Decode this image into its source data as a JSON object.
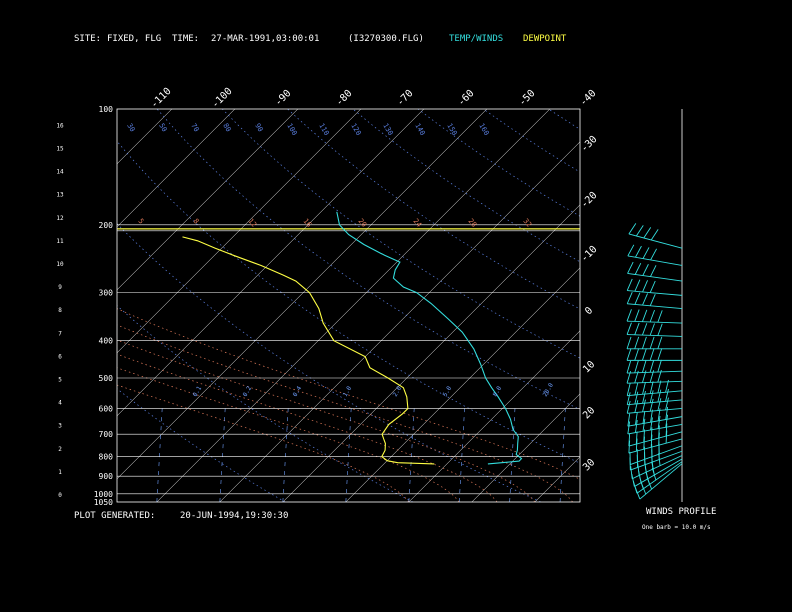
{
  "header": {
    "site_label": "SITE:",
    "site_value": "FIXED, FLG",
    "time_label": "TIME:",
    "time_value": "27-MAR-1991,03:00:01",
    "file_value": "(I3270300.FLG)",
    "temp_winds_label": "TEMP/WINDS",
    "dewpoint_label": "DEWPOINT"
  },
  "footer": {
    "plot_generated_label": "PLOT GENERATED:",
    "plot_generated_value": "20-JUN-1994,19:30:30"
  },
  "wind_panel": {
    "title": "WINDS PROFILE",
    "note": "One barb = 10.0 m/s"
  },
  "colors": {
    "background": "#000000",
    "text": "#ffffff",
    "temperature": "#33dddd",
    "dewpoint": "#ffff44",
    "isotherm": "#ffffff",
    "dry_adiabat": "#5a7fe0",
    "moist_adiabat": "#e07a5a",
    "mixing_ratio": "#6fa0ff"
  },
  "chart_data": {
    "type": "line",
    "subtype": "skew-t log-p",
    "pressure_axis": {
      "ticks": [
        100,
        200,
        300,
        400,
        500,
        600,
        700,
        800,
        900,
        1000,
        1050
      ],
      "range": [
        100,
        1050
      ],
      "scale": "log"
    },
    "height_axis": {
      "ticks": [
        0,
        1,
        2,
        3,
        4,
        5,
        6,
        7,
        8,
        9,
        10,
        11,
        12,
        13,
        14,
        15,
        16
      ]
    },
    "temperature_axis": {
      "top_ticks": [
        -110,
        -100,
        -90,
        -80,
        -70,
        -60,
        -50,
        -40
      ],
      "right_ticks": [
        -30,
        -20,
        -10,
        0,
        10,
        20,
        30
      ]
    },
    "dry_adiabat_labels": [
      {
        "p": 100,
        "t": "30"
      },
      {
        "p": 100,
        "t": "50"
      },
      {
        "p": 100,
        "t": "70"
      },
      {
        "p": 100,
        "t": "80"
      },
      {
        "p": 100,
        "t": "90"
      },
      {
        "p": 100,
        "t": "100"
      },
      {
        "p": 100,
        "t": "110"
      },
      {
        "p": 100,
        "t": "120"
      },
      {
        "p": 100,
        "t": "130"
      },
      {
        "p": 100,
        "t": "140"
      },
      {
        "p": 100,
        "t": "150"
      },
      {
        "p": 100,
        "t": "160"
      }
    ],
    "moist_adiabat_labels": [
      "5",
      "8",
      "12",
      "16",
      "20",
      "24",
      "28",
      "32"
    ],
    "mixing_ratio_labels": [
      "0.1",
      "0.2",
      "0.4",
      "1.0",
      "2.0",
      "5.0",
      "8.0",
      "20.0"
    ],
    "tropopause_p": 200,
    "series": [
      {
        "name": "TEMP/WINDS",
        "points": [
          [
            836,
            6.5
          ],
          [
            830,
            8.5
          ],
          [
            822,
            11.0
          ],
          [
            810,
            11.0
          ],
          [
            790,
            9.5
          ],
          [
            770,
            9.0
          ],
          [
            740,
            8.0
          ],
          [
            710,
            7.0
          ],
          [
            680,
            5.0
          ],
          [
            640,
            3.0
          ],
          [
            600,
            0.5
          ],
          [
            560,
            -2.5
          ],
          [
            530,
            -5.0
          ],
          [
            500,
            -7.5
          ],
          [
            460,
            -10.5
          ],
          [
            420,
            -14.0
          ],
          [
            380,
            -18.5
          ],
          [
            350,
            -23.0
          ],
          [
            320,
            -28.0
          ],
          [
            300,
            -32.0
          ],
          [
            290,
            -35.0
          ],
          [
            275,
            -38.0
          ],
          [
            262,
            -39.0
          ],
          [
            250,
            -39.5
          ],
          [
            240,
            -43.0
          ],
          [
            225,
            -48.0
          ],
          [
            212,
            -52.0
          ],
          [
            200,
            -55.0
          ],
          [
            185,
            -57.5
          ]
        ]
      },
      {
        "name": "DEWPOINT",
        "points": [
          [
            836,
            -2.0
          ],
          [
            830,
            -8.0
          ],
          [
            820,
            -10.0
          ],
          [
            800,
            -11.5
          ],
          [
            770,
            -12.0
          ],
          [
            740,
            -13.0
          ],
          [
            720,
            -14.0
          ],
          [
            700,
            -15.0
          ],
          [
            660,
            -15.5
          ],
          [
            620,
            -15.0
          ],
          [
            600,
            -15.0
          ],
          [
            560,
            -17.0
          ],
          [
            530,
            -19.0
          ],
          [
            500,
            -23.0
          ],
          [
            470,
            -27.5
          ],
          [
            440,
            -30.0
          ],
          [
            400,
            -37.5
          ],
          [
            360,
            -42.0
          ],
          [
            330,
            -45.0
          ],
          [
            300,
            -49.0
          ],
          [
            280,
            -53.0
          ],
          [
            270,
            -56.0
          ],
          [
            255,
            -61.0
          ],
          [
            240,
            -67.0
          ],
          [
            230,
            -71.0
          ],
          [
            220,
            -75.0
          ],
          [
            215,
            -78.0
          ]
        ]
      }
    ],
    "wind_profile": [
      {
        "p": 835,
        "dir": 230,
        "spd": 30
      },
      {
        "p": 825,
        "dir": 235,
        "spd": 35
      },
      {
        "p": 812,
        "dir": 240,
        "spd": 40
      },
      {
        "p": 795,
        "dir": 245,
        "spd": 45
      },
      {
        "p": 775,
        "dir": 250,
        "spd": 50
      },
      {
        "p": 750,
        "dir": 250,
        "spd": 50
      },
      {
        "p": 720,
        "dir": 255,
        "spd": 55
      },
      {
        "p": 690,
        "dir": 255,
        "spd": 55
      },
      {
        "p": 660,
        "dir": 260,
        "spd": 55
      },
      {
        "p": 630,
        "dir": 260,
        "spd": 55
      },
      {
        "p": 600,
        "dir": 265,
        "spd": 55
      },
      {
        "p": 570,
        "dir": 265,
        "spd": 55
      },
      {
        "p": 540,
        "dir": 265,
        "spd": 55
      },
      {
        "p": 510,
        "dir": 268,
        "spd": 50
      },
      {
        "p": 480,
        "dir": 268,
        "spd": 50
      },
      {
        "p": 450,
        "dir": 270,
        "spd": 50
      },
      {
        "p": 420,
        "dir": 270,
        "spd": 50
      },
      {
        "p": 390,
        "dir": 272,
        "spd": 45
      },
      {
        "p": 360,
        "dir": 272,
        "spd": 45
      },
      {
        "p": 330,
        "dir": 275,
        "spd": 40
      },
      {
        "p": 305,
        "dir": 275,
        "spd": 40
      },
      {
        "p": 280,
        "dir": 278,
        "spd": 35
      },
      {
        "p": 255,
        "dir": 280,
        "spd": 35
      },
      {
        "p": 230,
        "dir": 285,
        "spd": 40
      }
    ]
  }
}
